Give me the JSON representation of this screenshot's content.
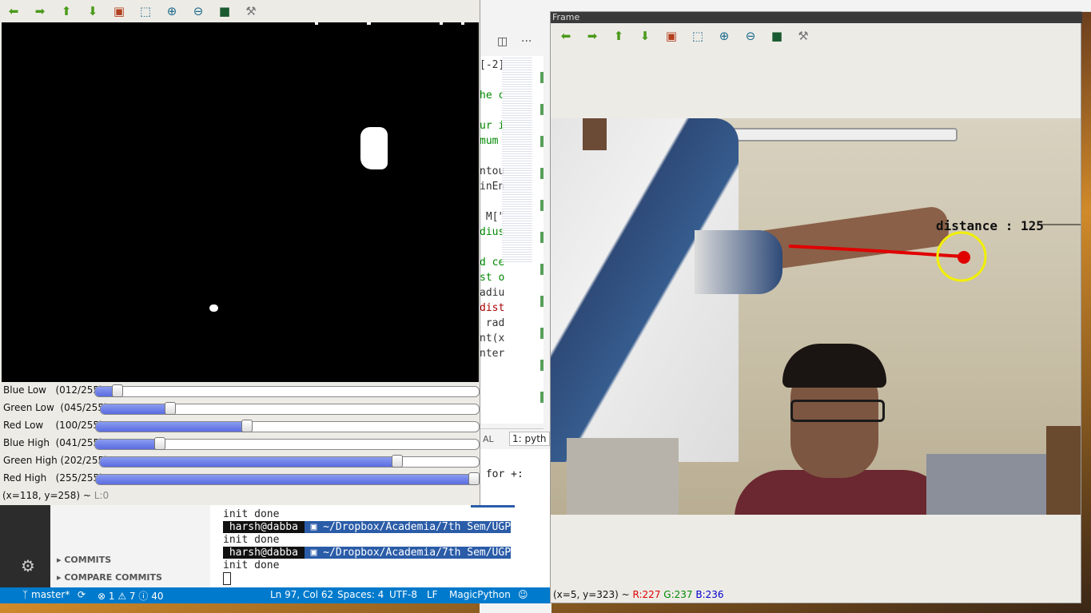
{
  "colors": {
    "accent": "#007acc",
    "mask_bg": "#000000",
    "slider_fill": "#6a7ce8",
    "tracker_ring": "#f2f000",
    "trail": "#e00000"
  },
  "vscode": {
    "code_lines": [
      "[-2]",
      "",
      "he c",
      "",
      "ur i",
      "mum ",
      "",
      "ntou",
      "inEn",
      "",
      " M[\"",
      "dius",
      "",
      "d ce",
      "st o",
      "adiu",
      "dist",
      " rad",
      "nt(x",
      "nter"
    ],
    "panel_tab_left": "AL",
    "panel_tab_select": "1: pyth",
    "term_prompt_fragment": " for +:",
    "terminal": [
      {
        "type": "path",
        "text": "h Sem/U"
      },
      {
        "type": "out",
        "text": "init done"
      },
      {
        "type": "prompt",
        "user": " harsh@dabba ",
        "path": " ▣ ~/Dropbox/Academia/7th Sem/UGP"
      },
      {
        "type": "out",
        "text": "init done"
      },
      {
        "type": "prompt",
        "user": " harsh@dabba ",
        "path": " ▣ ~/Dropbox/Academia/7th Sem/UGP"
      },
      {
        "type": "out",
        "text": "init done"
      }
    ],
    "sidebar": {
      "commits": "COMMITS",
      "compare_commits": "COMPARE COMMITS"
    },
    "status": {
      "branch": "master*",
      "errors": "1",
      "warnings": "7",
      "infos": "40",
      "position": "Ln 97, Col 62",
      "spaces": "Spaces: 4",
      "encoding": "UTF-8",
      "eol": "LF",
      "language": "MagicPython"
    }
  },
  "mask_window": {
    "toolbar_icons": [
      "arrow-left-icon",
      "arrow-right-icon",
      "arrow-up-icon",
      "arrow-down-icon",
      "image-icon",
      "zoom-rect-icon",
      "zoom-in-icon",
      "zoom-out-icon",
      "save-icon",
      "properties-icon"
    ],
    "sliders": [
      {
        "label": "Blue Low   (012/255)",
        "value": 12
      },
      {
        "label": "Green Low  (045/255)",
        "value": 45
      },
      {
        "label": "Red Low    (100/255)",
        "value": 100
      },
      {
        "label": "Blue High  (041/255)",
        "value": 41
      },
      {
        "label": "Green High (202/255)",
        "value": 202
      },
      {
        "label": "Red High   (255/255)",
        "value": 255
      }
    ],
    "status_coords": "(x=118, y=258) ~ ",
    "status_level": "L:0"
  },
  "frame_window": {
    "title": "Frame",
    "overlay_text": "distance : 125",
    "status_coords": "(x=5, y=323) ~ ",
    "status_r": "R:227",
    "status_g": "G:237",
    "status_b": "B:236"
  }
}
